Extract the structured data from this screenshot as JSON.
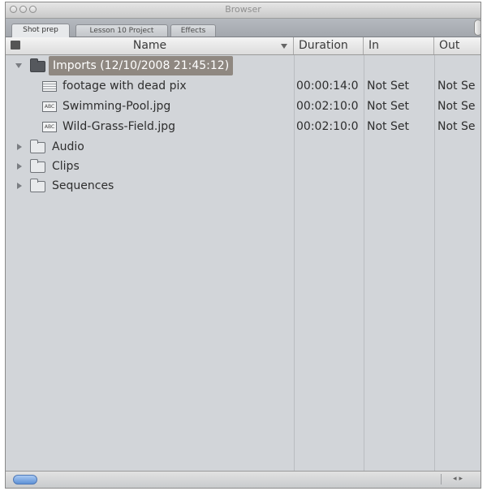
{
  "window": {
    "title": "Browser"
  },
  "tabs": [
    {
      "label": "Shot prep",
      "active": true
    },
    {
      "label": "Lesson 10 Project",
      "active": false
    },
    {
      "label": "Effects",
      "active": false
    }
  ],
  "columns": {
    "name": "Name",
    "duration": "Duration",
    "in": "In",
    "out": "Out"
  },
  "rows": [
    {
      "type": "folder",
      "expanded": true,
      "selected": true,
      "name": "Imports (12/10/2008 21:45:12)",
      "duration": "",
      "in": "",
      "out": "",
      "icon": "folder-icon"
    },
    {
      "type": "clip",
      "name": "footage with dead pix",
      "duration": "00:00:14:0",
      "in": "Not Set",
      "out": "Not Se",
      "icon": "clip-icon"
    },
    {
      "type": "still",
      "name": "Swimming-Pool.jpg",
      "duration": "00:02:10:0",
      "in": "Not Set",
      "out": "Not Se",
      "icon": "still-image-icon"
    },
    {
      "type": "still",
      "name": "Wild-Grass-Field.jpg",
      "duration": "00:02:10:0",
      "in": "Not Set",
      "out": "Not Se",
      "icon": "still-image-icon"
    },
    {
      "type": "folder",
      "expanded": false,
      "name": "Audio",
      "icon": "folder-icon"
    },
    {
      "type": "folder",
      "expanded": false,
      "name": "Clips",
      "icon": "folder-icon"
    },
    {
      "type": "folder",
      "expanded": false,
      "name": "Sequences",
      "icon": "folder-icon"
    }
  ],
  "colors": {
    "selection": "#8f8881",
    "background": "#d2d5d9",
    "header": "#e8e8e8"
  }
}
